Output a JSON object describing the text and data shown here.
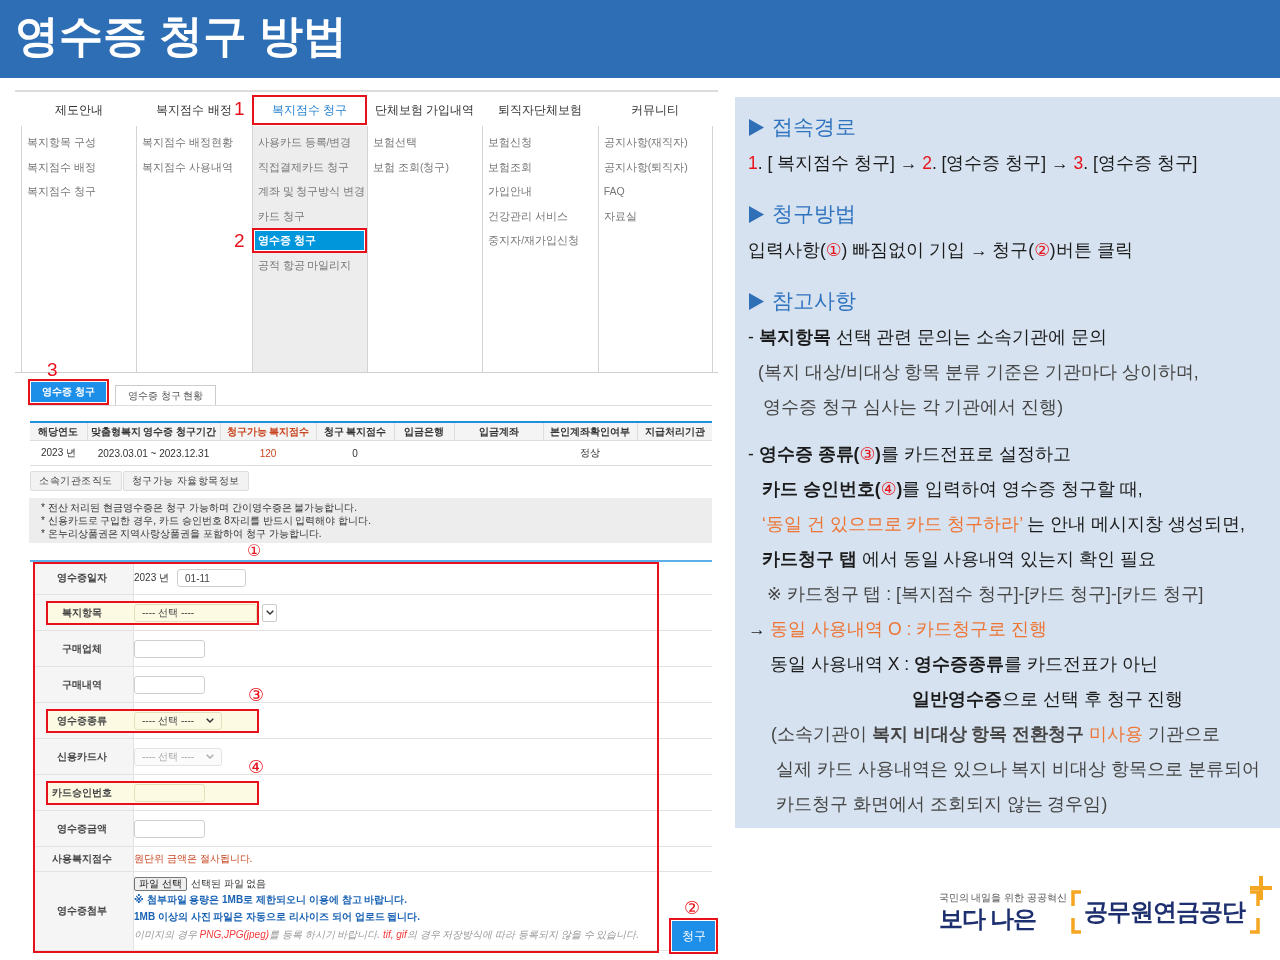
{
  "title": "영수증 청구 방법",
  "screenshot": {
    "nav": {
      "menus": [
        {
          "label": "제도안내",
          "selected": false,
          "items": [
            {
              "label": "복지항목 구성",
              "selected": false
            },
            {
              "label": "복지점수 배정",
              "selected": false
            },
            {
              "label": "복지점수 청구",
              "selected": false
            }
          ]
        },
        {
          "label": "복지점수 배정",
          "selected": false,
          "items": [
            {
              "label": "복지점수 배정현황",
              "selected": false
            },
            {
              "label": "복지점수 사용내역",
              "selected": false
            }
          ]
        },
        {
          "label": "복지점수 청구",
          "selected": true,
          "callout": "1",
          "items": [
            {
              "label": "사용카드 등록/변경",
              "selected": false
            },
            {
              "label": "직접결제카드 청구",
              "selected": false
            },
            {
              "label": "계좌 및 청구방식 변경",
              "selected": false
            },
            {
              "label": "카드 청구",
              "selected": false
            },
            {
              "label": "영수증 청구",
              "selected": true,
              "callout": "2"
            },
            {
              "label": "공적 항공 마일리지",
              "selected": false
            }
          ]
        },
        {
          "label": "단체보험 가입내역",
          "selected": false,
          "items": [
            {
              "label": "보험선택",
              "selected": false
            },
            {
              "label": "보험 조회(청구)",
              "selected": false
            }
          ]
        },
        {
          "label": "퇴직자단체보험",
          "selected": false,
          "items": [
            {
              "label": "보험신청",
              "selected": false
            },
            {
              "label": "보험조회",
              "selected": false
            },
            {
              "label": "가입안내",
              "selected": false
            },
            {
              "label": "건강관리 서비스",
              "selected": false
            },
            {
              "label": "중지자/재가입신청",
              "selected": false
            }
          ]
        },
        {
          "label": "커뮤니티",
          "selected": false,
          "items": [
            {
              "label": "공지사항(재직자)",
              "selected": false
            },
            {
              "label": "공지사항(퇴직자)",
              "selected": false
            },
            {
              "label": "FAQ",
              "selected": false
            },
            {
              "label": "자료실",
              "selected": false
            }
          ]
        }
      ]
    },
    "tabs": [
      {
        "label": "영수증 청구",
        "selected": true,
        "callout": "3"
      },
      {
        "label": "영수증 청구 현황",
        "selected": false
      }
    ],
    "table": {
      "columns": [
        {
          "label": "해당연도",
          "emphasis": false
        },
        {
          "label": "맞춤형복지 영수증 청구기간",
          "emphasis": false
        },
        {
          "label": "청구가능 복지점수",
          "emphasis": true
        },
        {
          "label": "청구 복지점수",
          "emphasis": false
        },
        {
          "label": "입금은행",
          "emphasis": false
        },
        {
          "label": "입금계좌",
          "emphasis": false
        },
        {
          "label": "본인계좌확인여부",
          "emphasis": false
        },
        {
          "label": "지급처리기관",
          "emphasis": false
        }
      ],
      "rows": [
        [
          "2023 년",
          "2023.03.01 ~ 2023.12.31",
          "120",
          "0",
          null,
          null,
          "정상",
          null
        ]
      ]
    },
    "buttons": [
      "소속기관조직도",
      "청구가능 자율항목정보"
    ],
    "notice": [
      "* 전산 처리된 현금영수증은 청구 가능하며 간이영수증은 불가능합니다.",
      "* 신용카드로 구입한 경우, 카드 승인번호 8자리를 반드시 입력해야 합니다.",
      "* 온누리상품권은 지역사랑상품권을 포함하여 청구 가능합니다."
    ],
    "form": {
      "callout": "①",
      "rows": [
        {
          "label": "영수증일자",
          "kind": "date",
          "marked": false,
          "disabled": false,
          "prefix": "2023 년",
          "value": "01-11"
        },
        {
          "label": "복지항목",
          "kind": "dropdown",
          "marked": true,
          "disabled": false,
          "value": "---- 선택 ----"
        },
        {
          "label": "구매업체",
          "kind": "input",
          "marked": false,
          "disabled": false
        },
        {
          "label": "구매내역",
          "kind": "input",
          "marked": false,
          "disabled": false
        },
        {
          "label": "영수증종류",
          "kind": "select",
          "marked": true,
          "disabled": false,
          "callout": "③",
          "value": "---- 선택 ----"
        },
        {
          "label": "신용카드사",
          "kind": "select",
          "marked": false,
          "disabled": true,
          "value": "---- 선택 ----"
        },
        {
          "label": "카드승인번호",
          "kind": "input",
          "marked": true,
          "disabled": false,
          "callout": "④"
        },
        {
          "label": "영수증금액",
          "kind": "input",
          "marked": false,
          "disabled": false
        },
        {
          "label": "사용복지점수",
          "kind": "note",
          "marked": false,
          "text": "원단위 금액은 절사됩니다."
        },
        {
          "label": "영수증첨부",
          "kind": "file",
          "marked": false,
          "disabled": false,
          "button": "파일 선택",
          "status": "선택된 파일 없음",
          "notes": [
            "※ 첨부파일 용량은 1MB로 제한되오니 이용에 참고 바랍니다.",
            "1MB 이상의 사진 파일은 자동으로 리사이즈 되어 업로드 됩니다."
          ],
          "hint": [
            {
              "text": "이미지의 경우 ",
              "kind": "plain"
            },
            {
              "text": "PNG,JPG(jpeg)",
              "kind": "accent"
            },
            {
              "text": "를 등록 하시기 바랍니다. ",
              "kind": "plain"
            },
            {
              "text": "tif, gif",
              "kind": "accent"
            },
            {
              "text": "의 경우 저장방식에 따라 등록되지 않을 수 있습니다.",
              "kind": "plain"
            }
          ]
        }
      ]
    },
    "submit": {
      "label": "청구",
      "callout": "②"
    }
  },
  "guide": {
    "sections": [
      {
        "heading": "접속경로",
        "blocks": [
          {
            "lines": [
              {
                "kind": "lead",
                "segments": [
                  {
                    "text": "1",
                    "kind": "step"
                  },
                  {
                    "text": ". [ 복지점수 청구] → ",
                    "kind": "plain"
                  },
                  {
                    "text": "2",
                    "kind": "step"
                  },
                  {
                    "text": ". [영수증 청구] → ",
                    "kind": "plain"
                  },
                  {
                    "text": "3",
                    "kind": "step"
                  },
                  {
                    "text": ". [영수증 청구]",
                    "kind": "plain"
                  }
                ]
              }
            ]
          }
        ]
      },
      {
        "heading": "청구방법",
        "blocks": [
          {
            "lines": [
              {
                "kind": "lead",
                "segments": [
                  {
                    "text": "입력사항(",
                    "kind": "plain"
                  },
                  {
                    "text": "①",
                    "kind": "marker"
                  },
                  {
                    "text": ") 빠짐없이 기입 → 청구(",
                    "kind": "plain"
                  },
                  {
                    "text": "②",
                    "kind": "marker"
                  },
                  {
                    "text": ")버튼 클릭",
                    "kind": "plain"
                  }
                ]
              }
            ]
          }
        ]
      },
      {
        "heading": "참고사항",
        "blocks": [
          {
            "lines": [
              {
                "kind": "lead",
                "text": "- **복지항목** 선택 관련 문의는 소속기관에 문의"
              },
              {
                "kind": "note",
                "text": "(복지 대상/비대상 항목 분류 기준은 기관마다 상이하며,"
              },
              {
                "kind": "notetail",
                "text": "영수증 청구 심사는 각 기관에서 진행)"
              }
            ]
          },
          {
            "lines": [
              {
                "kind": "lead",
                "segments": [
                  {
                    "text": "- **영수증 종류(**",
                    "kind": "plain"
                  },
                  {
                    "text": "③",
                    "kind": "marker"
                  },
                  {
                    "text": "**)**를 카드전표로 설정하고",
                    "kind": "plain"
                  }
                ]
              },
              {
                "kind": "follow",
                "segments": [
                  {
                    "text": "**카드 승인번호(**",
                    "kind": "plain"
                  },
                  {
                    "text": "④",
                    "kind": "marker"
                  },
                  {
                    "text": "**)**를 입력하여 영수증 청구할 때,",
                    "kind": "plain"
                  }
                ]
              },
              {
                "kind": "follow",
                "segments": [
                  {
                    "text": "‘동일 건 있으므로 카드 청구하라’",
                    "kind": "accent"
                  },
                  {
                    "text": " 는 안내 메시지창 생성되면,",
                    "kind": "plain"
                  }
                ]
              },
              {
                "kind": "follow",
                "text": "**카드청구 탭** 에서 동일 사용내역 있는지 확인 필요"
              },
              {
                "kind": "ref",
                "text": "※ 카드청구 탭 : [복지점수 청구]-[카드 청구]-[카드 청구]"
              },
              {
                "kind": "lead",
                "segments": [
                  {
                    "text": "→ ",
                    "kind": "plain"
                  },
                  {
                    "text": "동일 사용내역 O : 카드청구로 진행",
                    "kind": "accent"
                  }
                ]
              },
              {
                "kind": "case",
                "text": "동일 사용내역 X : **영수증종류**를 카드전표가 아닌"
              },
              {
                "kind": "wrap",
                "text": "**일반영수증**으로 선택 후 청구 진행"
              },
              {
                "kind": "aside",
                "segments": [
                  {
                    "text": "(소속기관이 **복지 비대상 항목 전환청구** ",
                    "kind": "plain"
                  },
                  {
                    "text": "미사용",
                    "kind": "accent"
                  },
                  {
                    "text": " 기관으로",
                    "kind": "plain"
                  }
                ]
              },
              {
                "kind": "asidetail",
                "text": "실제 카드 사용내역은 있으나 복지 비대상 항목으로 분류되어"
              },
              {
                "kind": "asidetail",
                "text": "카드청구 화면에서 조회되지 않는 경우임)"
              }
            ]
          }
        ]
      }
    ]
  },
  "logo": {
    "tagline": "국민의 내일을 위한 공공혁신",
    "slogan": "보다 나은",
    "name": "공무원연금공단"
  }
}
